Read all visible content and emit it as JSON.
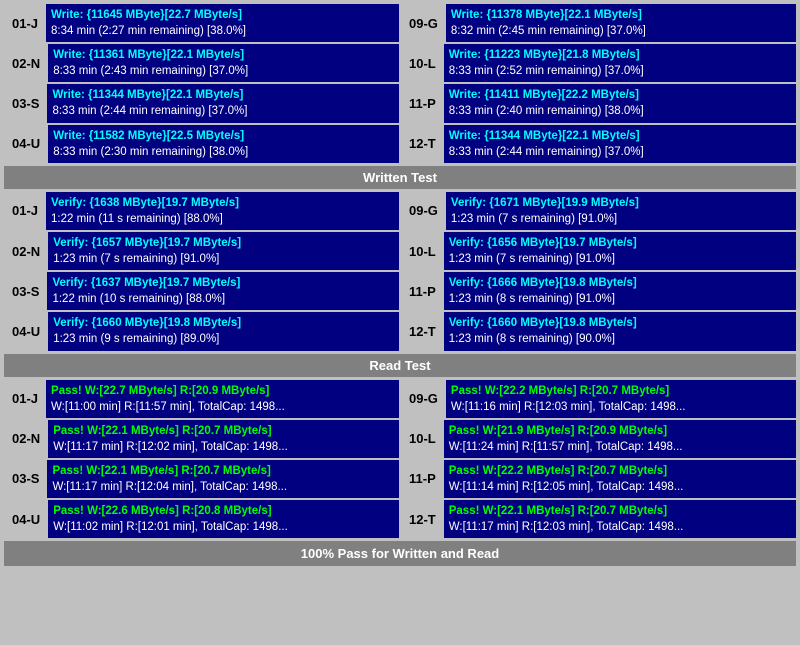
{
  "sections": {
    "write": {
      "rows": [
        {
          "id": "01-J",
          "line1": "Write: {11645 MByte}[22.7 MByte/s]",
          "line2": "8:34 min (2:27 min remaining)  [38.0%]"
        },
        {
          "id": "09-G",
          "line1": "Write: {11378 MByte}[22.1 MByte/s]",
          "line2": "8:32 min (2:45 min remaining)  [37.0%]"
        },
        {
          "id": "02-N",
          "line1": "Write: {11361 MByte}[22.1 MByte/s]",
          "line2": "8:33 min (2:43 min remaining)  [37.0%]"
        },
        {
          "id": "10-L",
          "line1": "Write: {11223 MByte}[21.8 MByte/s]",
          "line2": "8:33 min (2:52 min remaining)  [37.0%]"
        },
        {
          "id": "03-S",
          "line1": "Write: {11344 MByte}[22.1 MByte/s]",
          "line2": "8:33 min (2:44 min remaining)  [37.0%]"
        },
        {
          "id": "11-P",
          "line1": "Write: {11411 MByte}[22.2 MByte/s]",
          "line2": "8:33 min (2:40 min remaining)  [38.0%]"
        },
        {
          "id": "04-U",
          "line1": "Write: {11582 MByte}[22.5 MByte/s]",
          "line2": "8:33 min (2:30 min remaining)  [38.0%]"
        },
        {
          "id": "12-T",
          "line1": "Write: {11344 MByte}[22.1 MByte/s]",
          "line2": "8:33 min (2:44 min remaining)  [37.0%]"
        }
      ]
    },
    "written_test_label": "Written Test",
    "verify": {
      "rows": [
        {
          "id": "01-J",
          "line1": "Verify: {1638 MByte}[19.7 MByte/s]",
          "line2": "1:22 min (11 s remaining)  [88.0%]"
        },
        {
          "id": "09-G",
          "line1": "Verify: {1671 MByte}[19.9 MByte/s]",
          "line2": "1:23 min (7 s remaining)  [91.0%]"
        },
        {
          "id": "02-N",
          "line1": "Verify: {1657 MByte}[19.7 MByte/s]",
          "line2": "1:23 min (7 s remaining)  [91.0%]"
        },
        {
          "id": "10-L",
          "line1": "Verify: {1656 MByte}[19.7 MByte/s]",
          "line2": "1:23 min (7 s remaining)  [91.0%]"
        },
        {
          "id": "03-S",
          "line1": "Verify: {1637 MByte}[19.7 MByte/s]",
          "line2": "1:22 min (10 s remaining)  [88.0%]"
        },
        {
          "id": "11-P",
          "line1": "Verify: {1666 MByte}[19.8 MByte/s]",
          "line2": "1:23 min (8 s remaining)  [91.0%]"
        },
        {
          "id": "04-U",
          "line1": "Verify: {1660 MByte}[19.8 MByte/s]",
          "line2": "1:23 min (9 s remaining)  [89.0%]"
        },
        {
          "id": "12-T",
          "line1": "Verify: {1660 MByte}[19.8 MByte/s]",
          "line2": "1:23 min (8 s remaining)  [90.0%]"
        }
      ]
    },
    "read_test_label": "Read Test",
    "read": {
      "rows": [
        {
          "id": "01-J",
          "line1": "Pass! W:[22.7 MByte/s] R:[20.9 MByte/s]",
          "line2": "W:[11:00 min] R:[11:57 min], TotalCap: 1498..."
        },
        {
          "id": "09-G",
          "line1": "Pass! W:[22.2 MByte/s] R:[20.7 MByte/s]",
          "line2": "W:[11:16 min] R:[12:03 min], TotalCap: 1498..."
        },
        {
          "id": "02-N",
          "line1": "Pass! W:[22.1 MByte/s] R:[20.7 MByte/s]",
          "line2": "W:[11:17 min] R:[12:02 min], TotalCap: 1498..."
        },
        {
          "id": "10-L",
          "line1": "Pass! W:[21.9 MByte/s] R:[20.9 MByte/s]",
          "line2": "W:[11:24 min] R:[11:57 min], TotalCap: 1498..."
        },
        {
          "id": "03-S",
          "line1": "Pass! W:[22.1 MByte/s] R:[20.7 MByte/s]",
          "line2": "W:[11:17 min] R:[12:04 min], TotalCap: 1498..."
        },
        {
          "id": "11-P",
          "line1": "Pass! W:[22.2 MByte/s] R:[20.7 MByte/s]",
          "line2": "W:[11:14 min] R:[12:05 min], TotalCap: 1498..."
        },
        {
          "id": "04-U",
          "line1": "Pass! W:[22.6 MByte/s] R:[20.8 MByte/s]",
          "line2": "W:[11:02 min] R:[12:01 min], TotalCap: 1498..."
        },
        {
          "id": "12-T",
          "line1": "Pass! W:[22.1 MByte/s] R:[20.7 MByte/s]",
          "line2": "W:[11:17 min] R:[12:03 min], TotalCap: 1498..."
        }
      ]
    },
    "bottom_label": "100% Pass for Written and Read"
  }
}
